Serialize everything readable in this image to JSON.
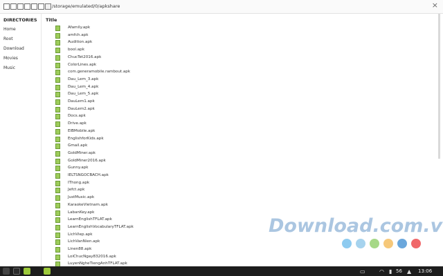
{
  "toolbar": {
    "path": "/storage/emulated/0/apkshare",
    "icons": [
      "copy-icon",
      "cut-icon",
      "delete-icon",
      "edit-icon",
      "new-file-icon",
      "new-folder-icon",
      "folder-icon"
    ],
    "close_glyph": "×"
  },
  "sidebar": {
    "heading": "DIRECTORIES",
    "items": [
      "Home",
      "Root",
      "Download",
      "Movies",
      "Music"
    ]
  },
  "main": {
    "column_title": "Title",
    "files": [
      "Afamily.apk",
      "amfch.apk",
      "Audition.apk",
      "bool.apk",
      "ChucTet2016.apk",
      "ColorLines.apk",
      "com.generamobile.rambout.apk",
      "Dau_Lem_3.apk",
      "Dau_Lem_4.apk",
      "Dau_Lem_5.apk",
      "DauLem1.apk",
      "DauLem2.apk",
      "Docs.apk",
      "Drive.apk",
      "EIBMobile.apk",
      "EnglishforKids.apk",
      "Gmail.apk",
      "GoldMiner.apk",
      "GoldMiner2016.apk",
      "Gunny.apk",
      "IELTSNGOCBACH.apk",
      "IThong.apk",
      "Jefct.apk",
      "JustMusic.apk",
      "KaraokeVietnam.apk",
      "LabanKey.apk",
      "LearnEnglishTFLAT.apk",
      "LearnEnglishVocabularyTFLAT.apk",
      "LichViep.apk",
      "LichVanNien.apk",
      "Linen88.apk",
      "LoiChucNgay832016.apk",
      "LuyenNgheTiengAnhTFLAT.apk"
    ]
  },
  "watermark": "Download.com.vn",
  "dot_colors": [
    "#8ecbf0",
    "#a6d3ee",
    "#a6d887",
    "#f6c87a",
    "#6aa7dc",
    "#f0686a"
  ],
  "taskbar": {
    "battery": "56",
    "time": "13:06",
    "accent": "#9cc93b"
  }
}
